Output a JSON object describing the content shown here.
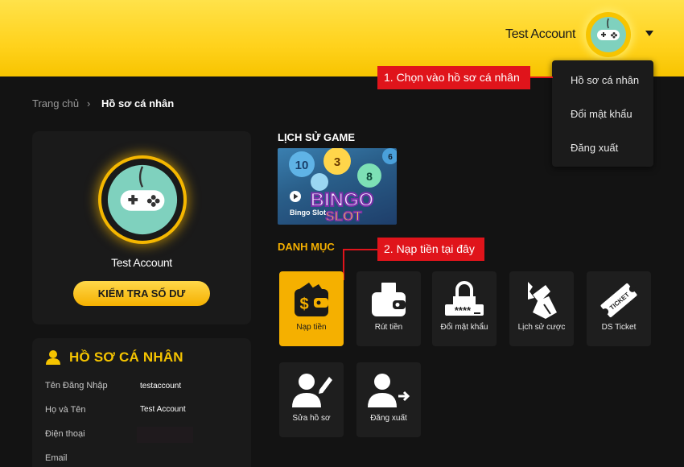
{
  "header": {
    "account_name": "Test Account"
  },
  "dropdown": {
    "items": [
      "Hồ sơ cá nhân",
      "Đổi mật khẩu",
      "Đăng xuất"
    ]
  },
  "callouts": {
    "step1": "1. Chọn vào hồ sơ cá nhân",
    "step2": "2. Nạp tiền tại đây"
  },
  "breadcrumb": {
    "home": "Trang chủ",
    "separator": "›",
    "current": "Hồ sơ cá nhân"
  },
  "profile": {
    "name": "Test Account",
    "check_balance_label": "KIỂM TRA SỐ DƯ"
  },
  "personal_info": {
    "title": "HỒ SƠ CÁ NHÂN",
    "fields": [
      {
        "label": "Tên Đăng Nhập",
        "value": "testaccount"
      },
      {
        "label": "Họ và Tên",
        "value": "Test Account"
      },
      {
        "label": "Điện thoại",
        "value": ""
      },
      {
        "label": "Email",
        "value": ""
      }
    ]
  },
  "game_history": {
    "title": "LỊCH SỬ GAME",
    "games": [
      {
        "name": "Bingo Slot"
      }
    ]
  },
  "categories": {
    "title": "DANH MỤC",
    "items": [
      {
        "label": "Nạp tiền",
        "icon": "wallet-money-icon",
        "active": true
      },
      {
        "label": "Rút tiền",
        "icon": "wallet-withdraw-icon",
        "active": false
      },
      {
        "label": "Đổi mật khẩu",
        "icon": "lock-password-icon",
        "active": false
      },
      {
        "label": "Lịch sử cược",
        "icon": "betting-history-icon",
        "active": false
      },
      {
        "label": "DS Ticket",
        "icon": "ticket-icon",
        "active": false
      },
      {
        "label": "Sửa hồ sơ",
        "icon": "edit-profile-icon",
        "active": false
      },
      {
        "label": "Đăng xuất",
        "icon": "logout-icon",
        "active": false
      }
    ]
  },
  "colors": {
    "accent": "#f5b000",
    "header": "#ffd21c",
    "callout": "#e0141b",
    "background": "#131313"
  }
}
